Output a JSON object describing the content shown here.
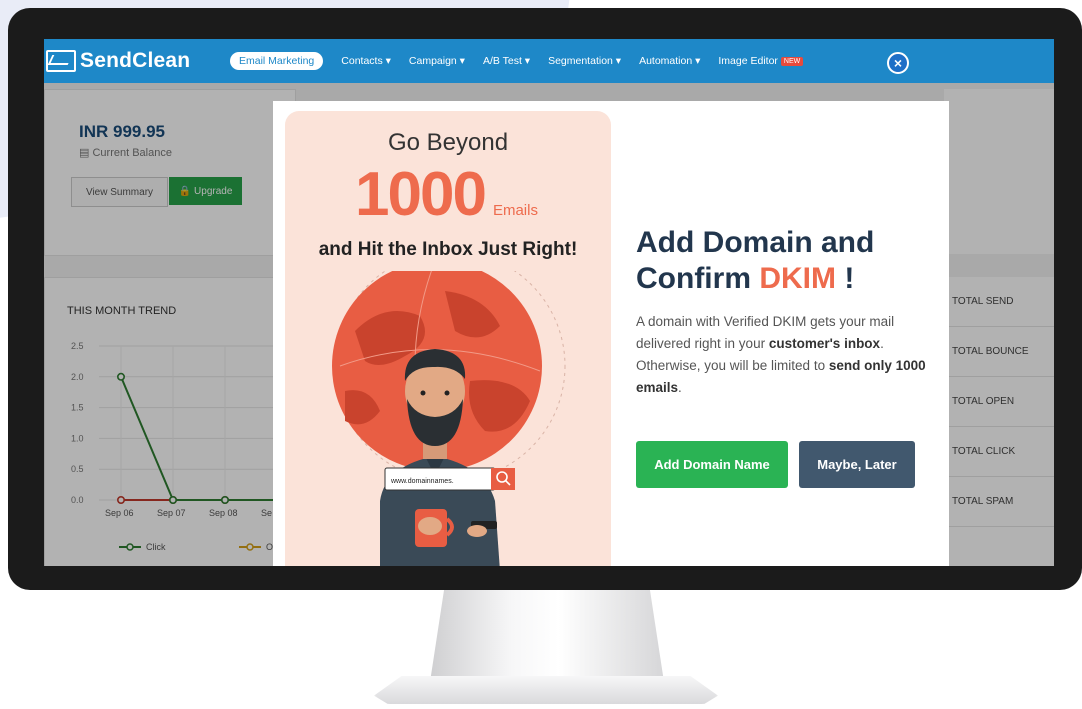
{
  "navbar": {
    "logo": "SendClean",
    "items": [
      {
        "label": "Email Marketing",
        "active": true
      },
      {
        "label": "Contacts ▾"
      },
      {
        "label": "Campaign ▾"
      },
      {
        "label": "A/B Test ▾"
      },
      {
        "label": "Segmentation ▾"
      },
      {
        "label": "Automation ▾"
      },
      {
        "label": "Image Editor",
        "badge": "NEW"
      }
    ]
  },
  "dashboard": {
    "balance": "INR 999.95",
    "balance_label": "Current Balance",
    "view_summary": "View Summary",
    "upgrade": "Upgrade",
    "trend_title": "THIS MONTH TREND",
    "stats": [
      "TOTAL SEND",
      "TOTAL BOUNCE",
      "TOTAL OPEN",
      "TOTAL CLICK",
      "TOTAL SPAM"
    ],
    "chart_legend": [
      "Click",
      "Ope"
    ]
  },
  "chart_data": {
    "type": "line",
    "x": [
      "Sep 06",
      "Sep 07",
      "Sep 08",
      "Se"
    ],
    "yticks": [
      "2.5",
      "2.0",
      "1.5",
      "1.0",
      "0.5",
      "0.0"
    ],
    "ylim": [
      0,
      2.5
    ],
    "series": [
      {
        "name": "Click",
        "values": [
          2.0,
          0,
          0,
          0
        ],
        "color": "#2e7d32"
      },
      {
        "name": "Ope",
        "values": [
          0,
          0,
          0,
          0
        ],
        "color": "#c0392b"
      }
    ]
  },
  "modal": {
    "promo_line1": "Go Beyond",
    "promo_number": "1000",
    "promo_unit": "Emails",
    "promo_line3": "and Hit the Inbox Just Right!",
    "search_text": "www.domainnames.",
    "headline_part1": "Add Domain and",
    "headline_part2": "Confirm ",
    "headline_accent": "DKIM",
    "headline_end": " !",
    "desc_1": "A domain with Verified DKIM gets your mail delivered right in your ",
    "desc_bold1": "customer's inbox",
    "desc_2": ". Otherwise, you will be limited to ",
    "desc_bold2": "send only 1000 emails",
    "desc_3": ".",
    "btn_add": "Add Domain Name",
    "btn_later": "Maybe, Later",
    "close": "×"
  },
  "colors": {
    "brand": "#1e88c8",
    "accent": "#ee6b4d",
    "green": "#2ab354",
    "slate": "#41586e"
  }
}
